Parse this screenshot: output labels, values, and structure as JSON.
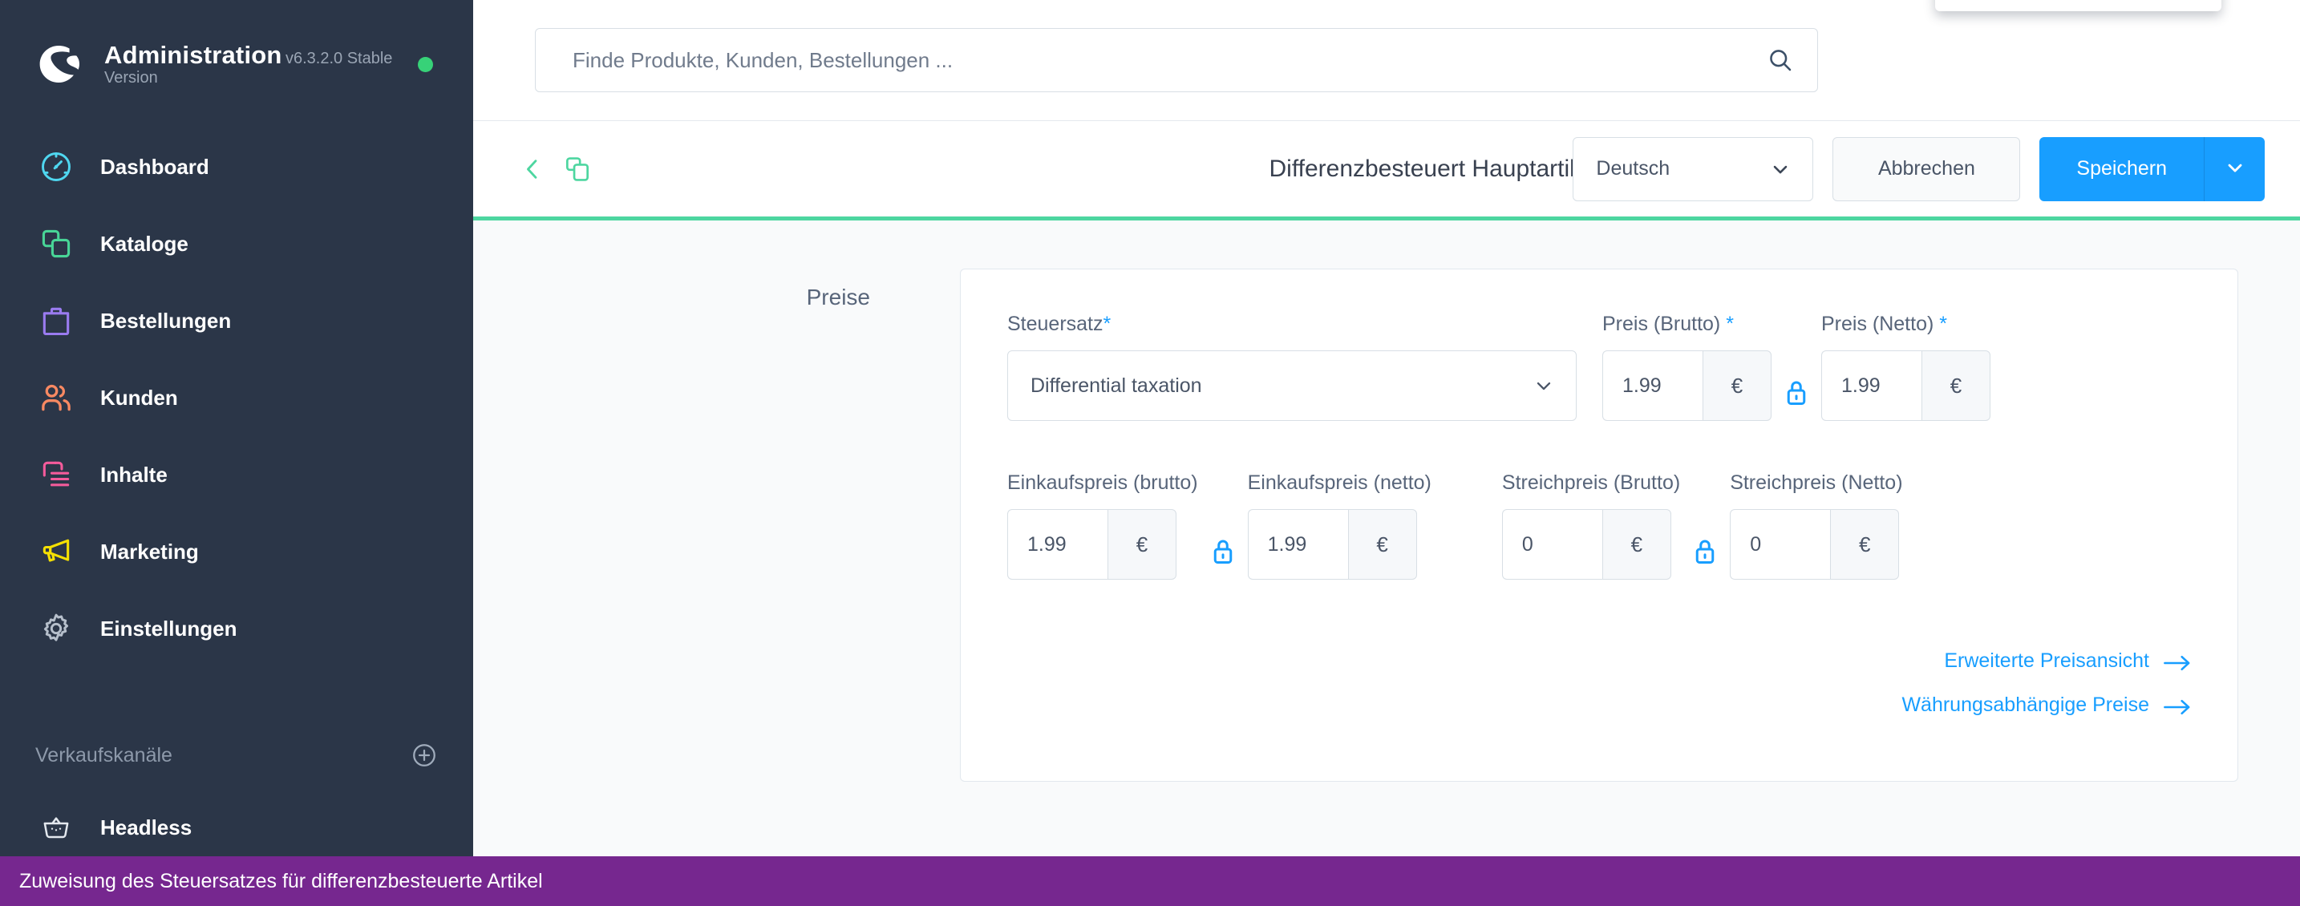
{
  "sidebar": {
    "brand": {
      "title": "Administration",
      "version": "v6.3.2.0 Stable Version",
      "status_dot_color": "#37d278",
      "logo_icon": "shopware-logo-icon"
    },
    "items": [
      {
        "label": "Dashboard",
        "icon": "dashboard-gauge-icon",
        "color": "#4fd7f0"
      },
      {
        "label": "Kataloge",
        "icon": "catalog-layers-icon",
        "color": "#48d597"
      },
      {
        "label": "Bestellungen",
        "icon": "orders-bag-icon",
        "color": "#9a7bf0"
      },
      {
        "label": "Kunden",
        "icon": "customers-users-icon",
        "color": "#f88962"
      },
      {
        "label": "Inhalte",
        "icon": "content-list-icon",
        "color": "#f45b9b"
      },
      {
        "label": "Marketing",
        "icon": "marketing-megaphone-icon",
        "color": "#f5e003"
      },
      {
        "label": "Einstellungen",
        "icon": "settings-gear-icon",
        "color": "#b6bfcb"
      }
    ],
    "section": {
      "label": "Verkaufskanäle",
      "add_icon": "plus-circle-icon"
    },
    "channels": [
      {
        "label": "Headless",
        "icon": "basket-icon"
      }
    ]
  },
  "search": {
    "placeholder": "Finde Produkte, Kunden, Bestellungen ...",
    "value": "",
    "icon": "search-icon"
  },
  "toolbar": {
    "back_icon": "chevron-left-icon",
    "duplicate_icon": "duplicate-copy-icon",
    "title": "Differenzbesteuert Hauptartikel",
    "language": {
      "value": "Deutsch",
      "chevron_icon": "chevron-down-icon"
    },
    "cancel_label": "Abbrechen",
    "save_label": "Speichern",
    "save_caret_icon": "chevron-down-icon",
    "accent_color": "#4dd6a0",
    "primary_color": "#189eff"
  },
  "prices_section": {
    "title": "Preise",
    "tax_rate": {
      "label": "Steuersatz",
      "required_marker": "*",
      "value": "Differential taxation",
      "chevron_icon": "chevron-down-icon"
    },
    "fields_row_1": [
      {
        "label": "Preis (Brutto)",
        "required_marker": " *",
        "value": "1.99",
        "currency": "€",
        "lock_icon": "lock-open-icon",
        "has_lock_after": true
      },
      {
        "label": "Preis (Netto)",
        "required_marker": " *",
        "value": "1.99",
        "currency": "€",
        "has_lock_after": false
      }
    ],
    "fields_row_2": [
      {
        "label": "Einkaufspreis (brutto)",
        "required_marker": "",
        "value": "1.99",
        "currency": "€",
        "lock_icon": "lock-open-icon",
        "has_lock_after": true
      },
      {
        "label": "Einkaufspreis (netto)",
        "required_marker": "",
        "value": "1.99",
        "currency": "€",
        "has_lock_after": false
      },
      {
        "label": "Streichpreis (Brutto)",
        "required_marker": "",
        "value": "0",
        "currency": "€",
        "lock_icon": "lock-open-icon",
        "has_lock_after": true
      },
      {
        "label": "Streichpreis (Netto)",
        "required_marker": "",
        "value": "0",
        "currency": "€",
        "has_lock_after": false
      }
    ],
    "links": [
      {
        "label": "Erweiterte Preisansicht",
        "icon": "arrow-right-icon"
      },
      {
        "label": "Währungsabhängige Preise",
        "icon": "arrow-right-icon"
      }
    ]
  },
  "banner": {
    "text": "Zuweisung des Steuersatzes für differenzbesteuerte Artikel",
    "background_color": "#76278f"
  }
}
